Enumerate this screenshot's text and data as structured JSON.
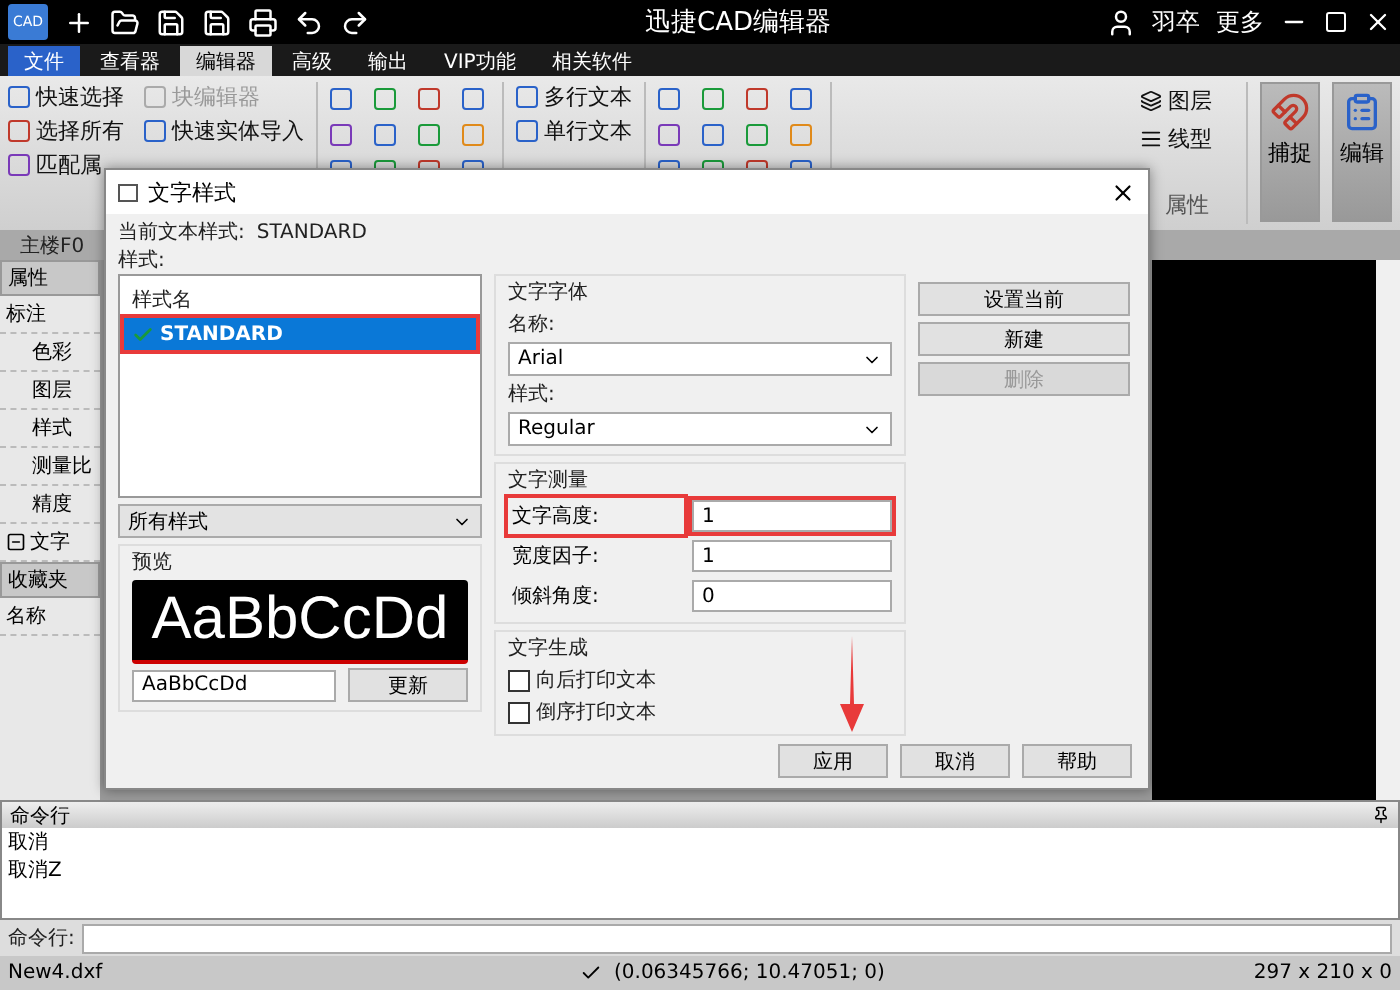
{
  "app": {
    "title": "迅捷CAD编辑器",
    "logo": "CAD",
    "user": "羽卒",
    "more": "更多"
  },
  "ribbon_tabs": [
    {
      "label": "文件",
      "selected": false,
      "kind": "file"
    },
    {
      "label": "查看器",
      "selected": false,
      "kind": "tab"
    },
    {
      "label": "编辑器",
      "selected": true,
      "kind": "tab"
    },
    {
      "label": "高级",
      "selected": false,
      "kind": "tab"
    },
    {
      "label": "输出",
      "selected": false,
      "kind": "tab"
    },
    {
      "label": "VIP功能",
      "selected": false,
      "kind": "tab"
    },
    {
      "label": "相关软件",
      "selected": false,
      "kind": "tab"
    }
  ],
  "ribbon": {
    "select_tools": [
      {
        "label": "快速选择",
        "disabled": false
      },
      {
        "label": "块编辑器",
        "disabled": true
      },
      {
        "label": "选择所有",
        "disabled": false
      },
      {
        "label": "快速实体导入",
        "disabled": false
      },
      {
        "label": "匹配属",
        "disabled": false
      }
    ],
    "text_tools": [
      "多行文本",
      "单行文本"
    ],
    "property_tools": [
      "图层",
      "线型"
    ],
    "group_label": "属性",
    "big_buttons": [
      "捕捉",
      "编辑"
    ]
  },
  "doc_tab": "主楼F0",
  "left_panel": {
    "header": "属性",
    "section": "标注",
    "items": [
      "色彩",
      "图层",
      "样式",
      "测量比",
      "精度"
    ],
    "group": {
      "label": "文字",
      "expanded": true
    },
    "favorites": "收藏夹",
    "name_label": "名称"
  },
  "dialog": {
    "title": "文字样式",
    "current_label": "当前文本样式:",
    "current_value": "STANDARD",
    "styles_label": "样式:",
    "list_header": "样式名",
    "styles": [
      {
        "name": "STANDARD",
        "selected": true,
        "highlighted": true
      }
    ],
    "filter": "所有样式",
    "preview_label": "预览",
    "preview_text": "AaBbCcDd",
    "preview_input": "AaBbCcDd",
    "update": "更新",
    "font": {
      "title": "文字字体",
      "name_label": "名称:",
      "name": "Arial",
      "style_label": "样式:",
      "style": "Regular"
    },
    "measure": {
      "title": "文字测量",
      "fields": [
        {
          "label": "文字高度:",
          "value": "1",
          "highlighted": true
        },
        {
          "label": "宽度因子:",
          "value": "1",
          "highlighted": false
        },
        {
          "label": "倾斜角度:",
          "value": "0",
          "highlighted": false
        }
      ]
    },
    "generate": {
      "title": "文字生成",
      "options": [
        {
          "label": "向后打印文本",
          "checked": false
        },
        {
          "label": "倒序打印文本",
          "checked": false
        }
      ]
    },
    "side_buttons": [
      {
        "label": "设置当前",
        "disabled": false
      },
      {
        "label": "新建",
        "disabled": false
      },
      {
        "label": "删除",
        "disabled": true
      }
    ],
    "buttons": [
      "应用",
      "取消",
      "帮助"
    ],
    "annotations": [
      {
        "kind": "arrow"
      }
    ]
  },
  "command": {
    "title": "命令行",
    "history": [
      "取消",
      "取消Z"
    ],
    "prompt": "命令行:"
  },
  "status": {
    "file": "New4.dxf",
    "coords": "(0.06345766; 10.47051; 0)",
    "size": "297 x 210 x 0"
  }
}
